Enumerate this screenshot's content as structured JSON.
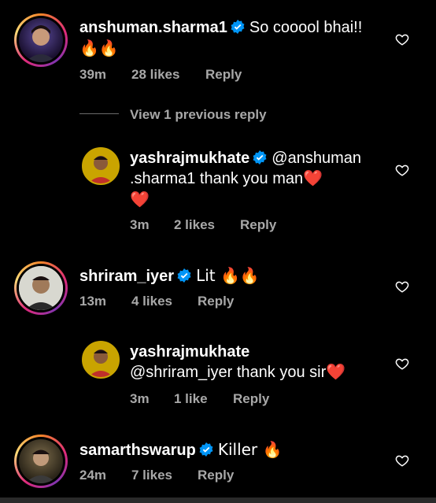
{
  "comments": [
    {
      "username": "anshuman.sharma1",
      "verified": true,
      "message": "So cooool bhai!!",
      "message_line2": "🔥🔥",
      "time": "39m",
      "likes": "28 likes",
      "reply_label": "Reply"
    },
    {
      "view_previous": "View 1 previous reply"
    },
    {
      "username": "yashrajmukhate",
      "verified": true,
      "message": "@anshuman",
      "message_line2": ".sharma1 thank you man❤️",
      "message_line3": "❤️",
      "time": "3m",
      "likes": "2 likes",
      "reply_label": "Reply"
    },
    {
      "username": "shriram_iyer",
      "verified": true,
      "message": "Lit 🔥🔥",
      "time": "13m",
      "likes": "4 likes",
      "reply_label": "Reply"
    },
    {
      "username": "yashrajmukhate",
      "verified": false,
      "message": "@shriram_iyer thank you sir❤️",
      "time": "3m",
      "likes": "1 like",
      "reply_label": "Reply"
    },
    {
      "username": "samarthswarup",
      "verified": true,
      "message": "Killer 🔥",
      "time": "24m",
      "likes": "7 likes",
      "reply_label": "Reply"
    }
  ],
  "colors": {
    "background": "#000000",
    "verified_blue": "#0095f6",
    "meta_gray": "#a8a8a8",
    "story_ring": "#dd2a7b"
  },
  "icons": {
    "verified": "verified-badge-icon",
    "like": "heart-outline-icon"
  }
}
